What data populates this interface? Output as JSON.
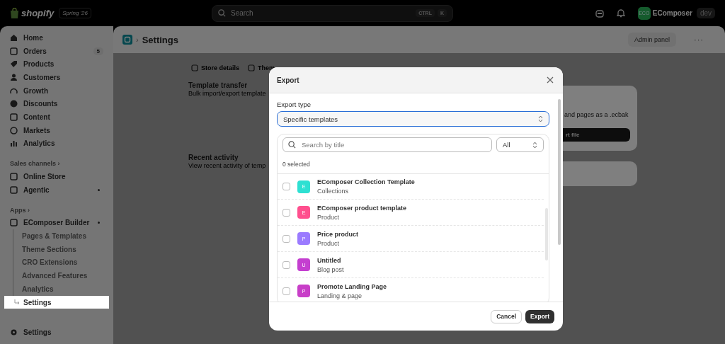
{
  "topbar": {
    "brand": "shopify",
    "release": "Spring '26",
    "search": {
      "placeholder": "Search",
      "keys": [
        "CTRL",
        "K"
      ]
    },
    "store": {
      "avatar": "ECO",
      "name": "EComposer",
      "tag": "dev"
    }
  },
  "sidebar": {
    "items": [
      {
        "label": "Home",
        "kind": "nav",
        "selected": false
      },
      {
        "label": "Orders",
        "kind": "nav",
        "badge": "5",
        "selected": false
      },
      {
        "label": "Products",
        "kind": "nav",
        "selected": false
      },
      {
        "label": "Customers",
        "kind": "nav",
        "selected": false
      },
      {
        "label": "Growth",
        "kind": "nav",
        "selected": false
      },
      {
        "label": "Discounts",
        "kind": "nav",
        "selected": false
      },
      {
        "label": "Content",
        "kind": "nav",
        "selected": false
      },
      {
        "label": "Markets",
        "kind": "nav",
        "selected": false
      },
      {
        "label": "Analytics",
        "kind": "nav",
        "selected": false
      },
      {
        "label": "Sales channels",
        "kind": "section",
        "chevron": "›"
      },
      {
        "label": "Online Store",
        "kind": "nav",
        "selected": false
      },
      {
        "label": "Agentic",
        "kind": "nav",
        "dot": true,
        "selected": false
      },
      {
        "label": "Apps",
        "kind": "section",
        "chevron": "›"
      },
      {
        "label": "EComposer Builder",
        "kind": "nav",
        "dot": true,
        "selected": false
      },
      {
        "label": "Pages & Templates",
        "kind": "sub",
        "selected": false
      },
      {
        "label": "Theme Sections",
        "kind": "sub",
        "selected": false
      },
      {
        "label": "CRO Extensions",
        "kind": "sub",
        "selected": false
      },
      {
        "label": "Advanced Features",
        "kind": "sub",
        "selected": false
      },
      {
        "label": "Analytics",
        "kind": "sub",
        "selected": false
      },
      {
        "label": "Settings",
        "kind": "sub",
        "selected": true
      }
    ],
    "footer": "Settings"
  },
  "header": {
    "separator": "›",
    "title": "Settings",
    "action": "Admin panel",
    "more": "···"
  },
  "page": {
    "tabs": [
      "Store details",
      "Them"
    ],
    "sections": [
      {
        "title": "Template transfer",
        "description": "Bulk import/export template"
      },
      {
        "title": "Recent activity",
        "description": "View recent activity of temp"
      }
    ],
    "card_text": "and pages as a .ecbak",
    "card_button": "rt file"
  },
  "modal": {
    "title": "Export",
    "field_label": "Export type",
    "field_value": "Specific templates",
    "search_placeholder": "Search by title",
    "filter": "All",
    "selected_count": "0 selected",
    "rows": [
      {
        "avatar": "E",
        "color": "#2ee0d2",
        "title": "EComposer Collection Template",
        "subtitle": "Collections",
        "checked": false
      },
      {
        "avatar": "E",
        "color": "#ff4f8e",
        "title": "EComposer product template",
        "subtitle": "Product",
        "checked": false
      },
      {
        "avatar": "P",
        "color": "#9b7bff",
        "title": "Price product",
        "subtitle": "Product",
        "checked": false
      },
      {
        "avatar": "U",
        "color": "#c43fd0",
        "title": "Untitled",
        "subtitle": "Blog post",
        "checked": false
      },
      {
        "avatar": "P",
        "color": "#c83fc8",
        "title": "Promote Landing Page",
        "subtitle": "Landing & page",
        "checked": false
      }
    ],
    "buttons": [
      "Cancel",
      "Export"
    ]
  }
}
